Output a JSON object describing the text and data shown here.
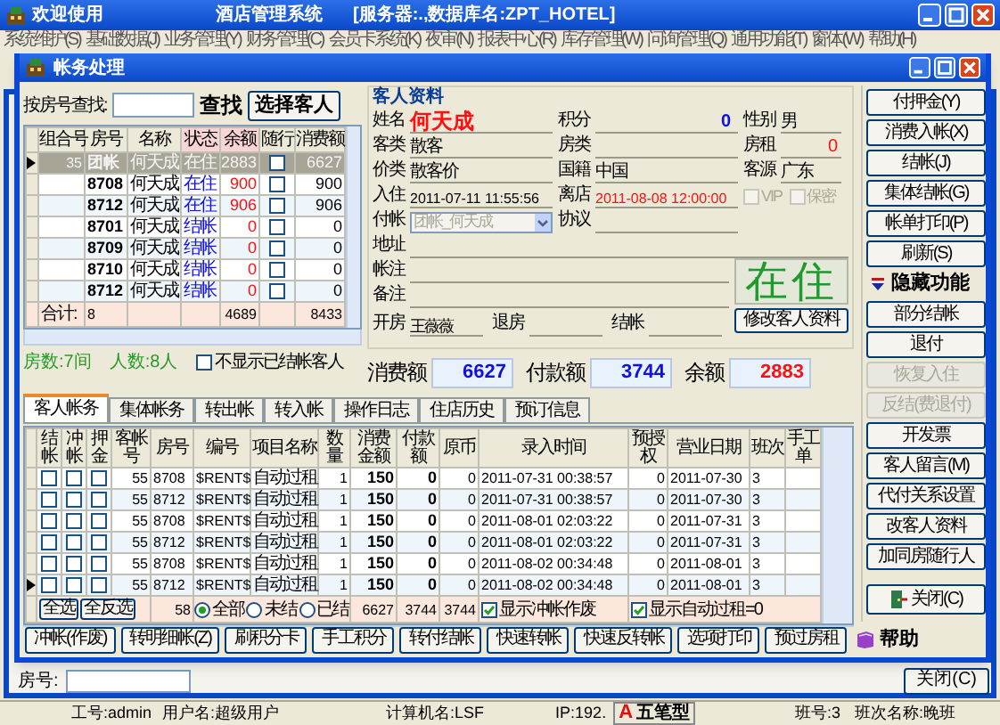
{
  "app_window": {
    "title": "欢迎使用",
    "app_name": "酒店管理系统",
    "server_info": "[服务器:.,数据库名:ZPT_HOTEL]"
  },
  "menu": [
    "系统维护(S)",
    "基础数据(J)",
    "业务管理(Y)",
    "财务管理(C)",
    "会员卡系统(K)",
    "夜审(N)",
    "报表中心(R)",
    "库存管理(W)",
    "问询管理(Q)",
    "通用功能(T)",
    "窗体(W)",
    "帮助(H)"
  ],
  "dialog": {
    "title": "帐务处理",
    "search": {
      "label": "按房号查找:",
      "find_label": "查找",
      "select_button": "选择客人"
    },
    "room_grid": {
      "columns": [
        "组合号",
        "房号",
        "名称",
        "状态",
        "余额",
        "随行",
        "消费额"
      ],
      "rows": [
        {
          "group": "35",
          "room": "团帐",
          "name": "何天成",
          "status": "在住",
          "balance": "2883",
          "companion": false,
          "consumption": "6627",
          "selected": true
        },
        {
          "room": "8708",
          "name": "何天成",
          "status": "在住",
          "balance": "900",
          "companion": false,
          "consumption": "900",
          "selected": false
        },
        {
          "room": "8712",
          "name": "何天成",
          "status": "在住",
          "balance": "906",
          "companion": false,
          "consumption": "906",
          "selected": false
        },
        {
          "room": "8701",
          "name": "何天成",
          "status": "结帐",
          "balance": "0",
          "companion": false,
          "consumption": "0",
          "selected": false
        },
        {
          "room": "8709",
          "name": "何天成",
          "status": "结帐",
          "balance": "0",
          "companion": false,
          "consumption": "0",
          "selected": false
        },
        {
          "room": "8710",
          "name": "何天成",
          "status": "结帐",
          "balance": "0",
          "companion": false,
          "consumption": "0",
          "selected": false
        },
        {
          "room": "8712",
          "name": "何天成",
          "status": "结帐",
          "balance": "0",
          "companion": false,
          "consumption": "0",
          "selected": false
        }
      ],
      "total": {
        "label": "合计:",
        "count": "8",
        "balance": "4689",
        "consumption": "8433"
      }
    },
    "room_summary": {
      "rooms": "房数:7间",
      "people": "人数:8人",
      "hide_checked_out": {
        "label": "不显示已结帐客人",
        "checked": false
      }
    },
    "guest_info": {
      "title": "客人资料",
      "rows": [
        [
          {
            "label": "姓名",
            "value": "何天成",
            "kind": "name"
          },
          {
            "label": "积分",
            "value": "0",
            "kind": "points"
          },
          {
            "label": "性别",
            "value": "男",
            "kind": "text"
          }
        ],
        [
          {
            "label": "客类",
            "value": "散客",
            "kind": "text"
          },
          {
            "label": "房类",
            "kind": "text"
          },
          {
            "label": "房租",
            "value": "0",
            "kind": "alert_number"
          }
        ],
        [
          {
            "label": "价类",
            "value": "散客价",
            "kind": "text"
          },
          {
            "label": "国籍",
            "value": "中国",
            "kind": "text"
          },
          {
            "label": "客源",
            "value": "广东",
            "kind": "text"
          }
        ],
        [
          {
            "label": "入住",
            "value": "2011-07-11 11:55:56",
            "kind": "datetime"
          },
          {
            "label": "离店",
            "value": "2011-08-08 12:00:00",
            "kind": "alert_datetime"
          },
          {
            "kind": "flags",
            "items": [
              {
                "label": "VIP",
                "checked": false,
                "disabled": true
              },
              {
                "label": "保密",
                "checked": false,
                "disabled": true
              }
            ]
          }
        ],
        [
          {
            "label": "付帐",
            "value": "团帐_何天成",
            "kind": "dropdown",
            "disabled": true
          },
          {
            "label": "协议",
            "kind": "text"
          }
        ],
        [
          {
            "label": "地址",
            "kind": "wide"
          }
        ]
      ],
      "notes": [
        {
          "label": "帐注"
        },
        {
          "label": "备注"
        }
      ],
      "staff": [
        {
          "label": "开房",
          "value": "王薇薇"
        },
        {
          "label": "退房"
        },
        {
          "label": "结帐"
        }
      ],
      "status_stamp": "在住",
      "edit_button": "修改客人资料"
    },
    "totals": [
      {
        "label": "消费额",
        "value": "6627",
        "kind": "consumption"
      },
      {
        "label": "付款额",
        "value": "3744",
        "kind": "payment"
      },
      {
        "label": "余额",
        "value": "2883",
        "kind": "balance"
      }
    ],
    "side_buttons": [
      {
        "label": "付押金(Y)",
        "kind": "button",
        "disabled": false
      },
      {
        "label": "消费入帐(X)",
        "kind": "button",
        "disabled": false
      },
      {
        "label": "结帐(J)",
        "kind": "button",
        "disabled": false
      },
      {
        "label": "集体结帐(G)",
        "kind": "button",
        "disabled": false
      },
      {
        "label": "帐单打印(P)",
        "kind": "button",
        "disabled": false
      },
      {
        "label": "刷新(S)",
        "kind": "button",
        "disabled": false
      },
      {
        "label": "隐藏功能",
        "kind": "section"
      },
      {
        "label": "部分结帐",
        "kind": "button",
        "disabled": false
      },
      {
        "label": "退付",
        "kind": "button",
        "disabled": false
      },
      {
        "label": "恢复入住",
        "kind": "button",
        "disabled": true
      },
      {
        "label": "反结(费退付)",
        "kind": "button",
        "disabled": true
      },
      {
        "label": "开发票",
        "kind": "button",
        "disabled": false
      },
      {
        "label": "客人留言(M)",
        "kind": "button",
        "disabled": false
      },
      {
        "label": "代付关系设置",
        "kind": "button",
        "disabled": false
      },
      {
        "label": "改客人资料",
        "kind": "button",
        "disabled": false
      },
      {
        "label": "加同房随行人",
        "kind": "button",
        "disabled": false
      },
      {
        "label": "关闭(C)",
        "kind": "close",
        "disabled": false
      }
    ],
    "tabs": [
      {
        "label": "客人帐务",
        "selected": true
      },
      {
        "label": "集体帐务",
        "selected": false
      },
      {
        "label": "转出帐",
        "selected": false
      },
      {
        "label": "转入帐",
        "selected": false
      },
      {
        "label": "操作日志",
        "selected": false
      },
      {
        "label": "住店历史",
        "selected": false
      },
      {
        "label": "预订信息",
        "selected": false
      }
    ],
    "ledger": {
      "columns": [
        "结帐",
        "冲帐",
        "押金",
        "客帐号",
        "房号",
        "编号",
        "项目名称",
        "数量",
        "消费金额",
        "付款额",
        "原币",
        "录入时间",
        "预授权",
        "营业日期",
        "班次",
        "手工单"
      ],
      "rows": [
        {
          "checkout": false,
          "reverse": false,
          "deposit": false,
          "account": "55",
          "room": "8708",
          "code": "$RENT$",
          "item": "自动过租",
          "qty": "1",
          "amount": "150",
          "payment": "0",
          "original": "0",
          "entry_time": "2011-07-31 00:38:57",
          "preauth": "0",
          "business_date": "2011-07-30",
          "shift": "3",
          "selected": false
        },
        {
          "checkout": false,
          "reverse": false,
          "deposit": false,
          "account": "55",
          "room": "8712",
          "code": "$RENT$",
          "item": "自动过租",
          "qty": "1",
          "amount": "150",
          "payment": "0",
          "original": "0",
          "entry_time": "2011-07-31 00:38:57",
          "preauth": "0",
          "business_date": "2011-07-30",
          "shift": "3",
          "selected": false
        },
        {
          "checkout": false,
          "reverse": false,
          "deposit": false,
          "account": "55",
          "room": "8708",
          "code": "$RENT$",
          "item": "自动过租",
          "qty": "1",
          "amount": "150",
          "payment": "0",
          "original": "0",
          "entry_time": "2011-08-01 02:03:22",
          "preauth": "0",
          "business_date": "2011-07-31",
          "shift": "3",
          "selected": false
        },
        {
          "checkout": false,
          "reverse": false,
          "deposit": false,
          "account": "55",
          "room": "8712",
          "code": "$RENT$",
          "item": "自动过租",
          "qty": "1",
          "amount": "150",
          "payment": "0",
          "original": "0",
          "entry_time": "2011-08-01 02:03:22",
          "preauth": "0",
          "business_date": "2011-07-31",
          "shift": "3",
          "selected": false
        },
        {
          "checkout": false,
          "reverse": false,
          "deposit": false,
          "account": "55",
          "room": "8708",
          "code": "$RENT$",
          "item": "自动过租",
          "qty": "1",
          "amount": "150",
          "payment": "0",
          "original": "0",
          "entry_time": "2011-08-02 00:34:48",
          "preauth": "0",
          "business_date": "2011-08-01",
          "shift": "3",
          "selected": false
        },
        {
          "checkout": false,
          "reverse": false,
          "deposit": false,
          "account": "55",
          "room": "8712",
          "code": "$RENT$",
          "item": "自动过租",
          "qty": "1",
          "amount": "150",
          "payment": "0",
          "original": "0",
          "entry_time": "2011-08-02 00:34:48",
          "preauth": "0",
          "business_date": "2011-08-01",
          "shift": "3",
          "selected": true
        }
      ],
      "footer": {
        "select_all": "全选",
        "invert_selection": "全反选",
        "count": "58",
        "filters": [
          {
            "label": "全部",
            "selected": true
          },
          {
            "label": "未结",
            "selected": false
          },
          {
            "label": "已结",
            "selected": false
          }
        ],
        "amount_total": "6627",
        "payment_total": "3744",
        "original_total": "3744",
        "options": [
          {
            "label": "显示冲帐作废",
            "checked": true
          },
          {
            "label": "显示自动过租=0",
            "checked": true
          }
        ]
      }
    },
    "bottom_buttons": [
      {
        "label": "冲帐(作废)",
        "kind": "button"
      },
      {
        "label": "转明细帐(Z)",
        "kind": "button"
      },
      {
        "label": "刷积分卡",
        "kind": "button"
      },
      {
        "label": "手工积分",
        "kind": "button"
      },
      {
        "label": "转付结帐",
        "kind": "button"
      },
      {
        "label": "快速转帐",
        "kind": "button"
      },
      {
        "label": "快速反转帐",
        "kind": "button"
      },
      {
        "label": "选项打印",
        "kind": "button"
      },
      {
        "label": "预过房租",
        "kind": "button"
      },
      {
        "label": "帮助",
        "kind": "help"
      }
    ]
  },
  "background_panel": {
    "room_label": "房号:",
    "close_button": "关闭(C)"
  },
  "status_bar": {
    "items": [
      "工号:admin",
      "用户名:超级用户",
      "计算机名:LSF",
      "IP:192.",
      "班号:3",
      "班次名称:晚班"
    ],
    "ime": {
      "mode": "A",
      "name": "五笔型"
    }
  }
}
